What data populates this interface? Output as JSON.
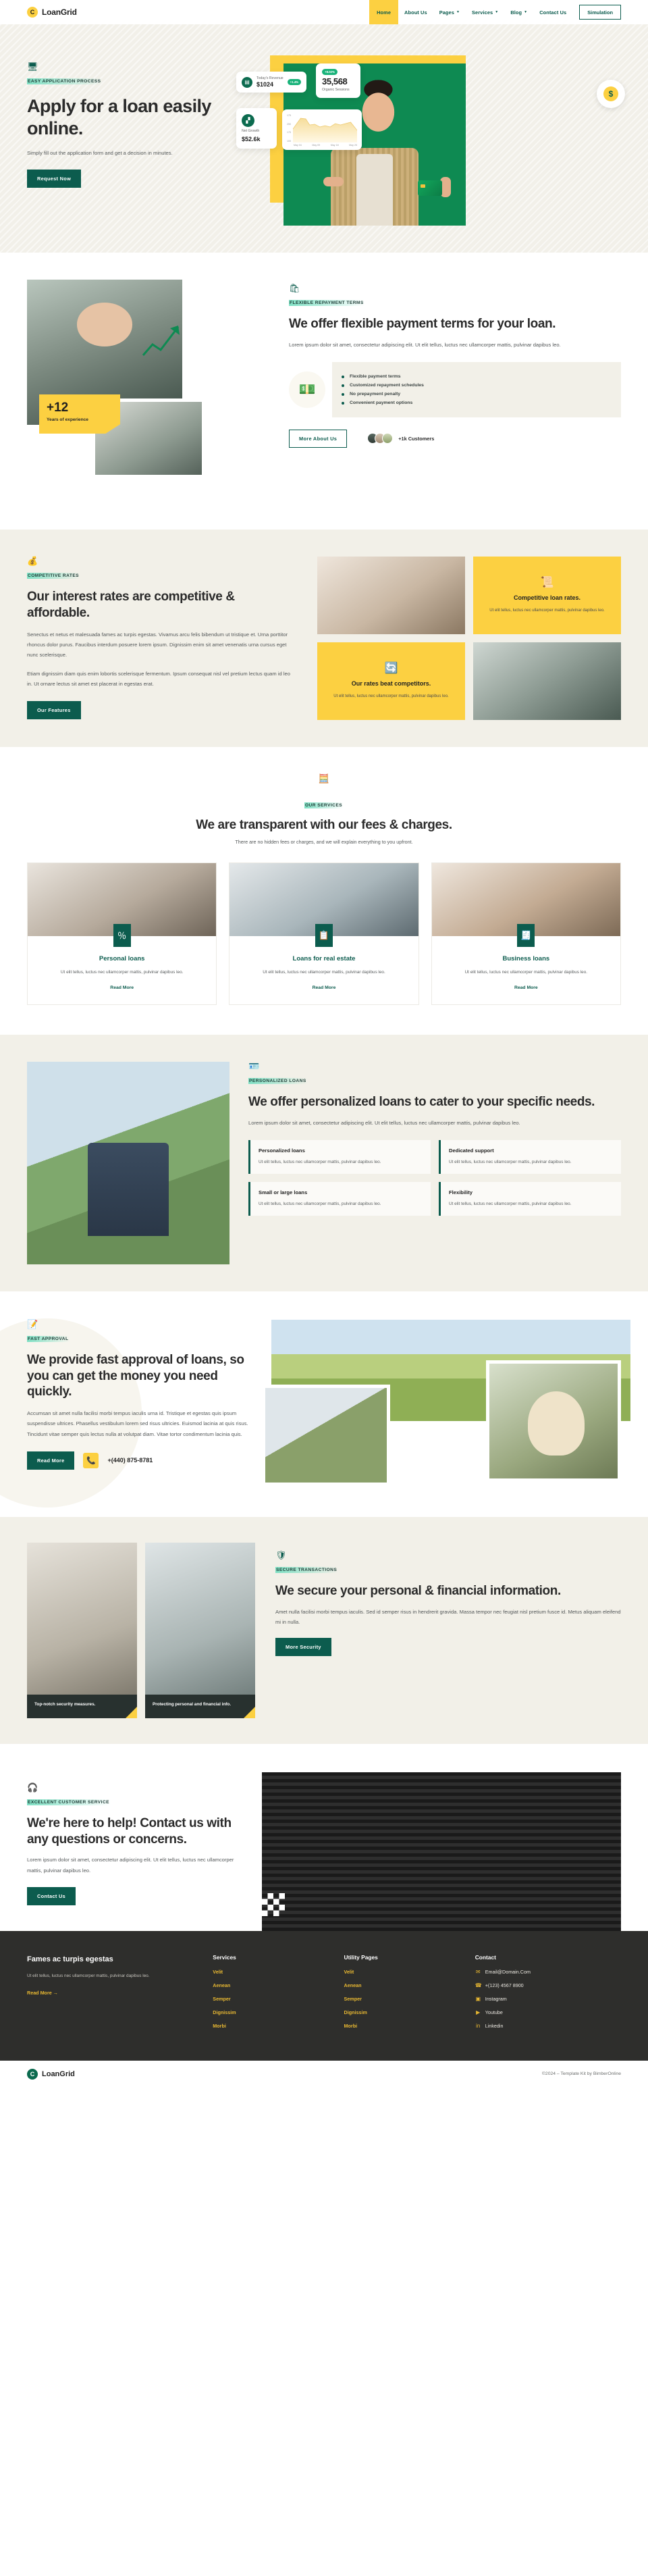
{
  "header": {
    "logo": {
      "mark": "C",
      "name": "LoanGrid"
    },
    "nav": [
      {
        "label": "Home",
        "active": true,
        "caret": false
      },
      {
        "label": "About Us",
        "active": false,
        "caret": false
      },
      {
        "label": "Pages",
        "active": false,
        "caret": true
      },
      {
        "label": "Services",
        "active": false,
        "caret": true
      },
      {
        "label": "Blog",
        "active": false,
        "caret": true
      },
      {
        "label": "Contact Us",
        "active": false,
        "caret": false
      }
    ],
    "cta": "Simulation"
  },
  "hero": {
    "eyebrow": "EASY APPLICATION PROCESS",
    "eyebrow_icon": "monitor-chart-icon",
    "title": "Apply for a loan easily online.",
    "desc": "Simply fill out the application form and get a decision in minutes.",
    "button": "Request Now",
    "cards": {
      "revenue": {
        "label": "Today's Revenue",
        "value": "$1024",
        "badge": "+1.4%",
        "icon": "receipt-icon"
      },
      "growth": {
        "label": "Net Growth",
        "value": "$52.6k",
        "icon": "bar-chart-icon"
      },
      "sessions": {
        "badge": "+8.02%",
        "value": "35,568",
        "label": "Organic Sessions"
      },
      "chart": {
        "y_ticks": [
          "175",
          "250",
          "175",
          "100"
        ],
        "x_ticks": [
          "May 04",
          "May 09",
          "May 18",
          "May 25"
        ]
      },
      "coin_icon": "dollar-refresh-icon"
    }
  },
  "flexible": {
    "eyebrow": "FLEXIBLE REPAYMENT TERMS",
    "eyebrow_icon": "bag-chart-icon",
    "title": "We offer flexible payment terms for your loan.",
    "desc": "Lorem ipsum dolor sit amet, consectetur adipiscing elit. Ut elit tellus, luctus nec ullamcorper mattis, pulvinar dapibus leo.",
    "bullets": [
      "Flexible payment terms",
      "Customized repayment schedules",
      "No prepayment penalty",
      "Convenient payment options"
    ],
    "wallet_icon": "money-wallet-icon",
    "button": "More About Us",
    "customers": "+1k Customers",
    "badge": {
      "number": "+12",
      "label": "Years of experience"
    }
  },
  "rates": {
    "eyebrow": "COMPETITIVE RATES",
    "eyebrow_icon": "money-bag-icon",
    "title": "Our interest rates are competitive & affordable.",
    "para1": "Senectus et netus et malesuada fames ac turpis egestas. Vivamus arcu felis bibendum ut tristique et. Urna porttitor rhoncus dolor purus. Faucibus interdum posuere lorem ipsum. Dignissim enim sit amet venenatis urna cursus eget nunc scelerisque.",
    "para2": "Etiam dignissim diam quis enim lobortis scelerisque fermentum. Ipsum consequat nisl vel pretium lectus quam id leo in. Ut ornare lectus sit amet est placerat in egestas erat.",
    "button": "Our Features",
    "cards": [
      {
        "title": "Competitive loan rates.",
        "desc": "Ut elit tellus, luctus nec ullamcorper mattis, pulvinar dapibus leo.",
        "icon": "certificate-dollar-icon"
      },
      {
        "title": "Our rates beat competitors.",
        "desc": "Ut elit tellus, luctus nec ullamcorper mattis, pulvinar dapibus leo.",
        "icon": "dollar-cycle-icon"
      }
    ]
  },
  "services": {
    "eyebrow": "OUR SERVICES",
    "eyebrow_icon": "calculator-icon",
    "title": "We are transparent with our fees & charges.",
    "subtitle": "There are no hidden fees or charges, and we will explain everything to you upfront.",
    "cards": [
      {
        "title": "Personal loans",
        "desc": "Ut elit tellus, luctus nec ullamcorper mattis, pulvinar dapibus leo.",
        "link": "Read More",
        "icon": "percent-doc-icon"
      },
      {
        "title": "Loans for real estate",
        "desc": "Ut elit tellus, luctus nec ullamcorper mattis, pulvinar dapibus leo.",
        "link": "Read More",
        "icon": "doc-user-icon"
      },
      {
        "title": "Business loans",
        "desc": "Ut elit tellus, luctus nec ullamcorper mattis, pulvinar dapibus leo.",
        "link": "Read More",
        "icon": "doc-calculator-icon"
      }
    ]
  },
  "personalized": {
    "eyebrow": "PERSONALIZED LOANS",
    "eyebrow_icon": "id-card-icon",
    "title": "We offer personalized loans to cater to your specific needs.",
    "desc": "Lorem ipsum dolor sit amet, consectetur adipiscing elit. Ut elit tellus, luctus nec ullamcorper mattis, pulvinar dapibus leo.",
    "features": [
      {
        "title": "Personalized loans",
        "desc": "Ut elit tellus, luctus nec ullamcorper mattis, pulvinar dapibus leo."
      },
      {
        "title": "Dedicated support",
        "desc": "Ut elit tellus, luctus nec ullamcorper mattis, pulvinar dapibus leo."
      },
      {
        "title": "Small or large loans",
        "desc": "Ut elit tellus, luctus nec ullamcorper mattis, pulvinar dapibus leo."
      },
      {
        "title": "Flexibility",
        "desc": "Ut elit tellus, luctus nec ullamcorper mattis, pulvinar dapibus leo."
      }
    ]
  },
  "fast": {
    "eyebrow": "FAST APPROVAL",
    "eyebrow_icon": "checklist-icon",
    "title": "We provide fast approval of loans, so you can get the money you need quickly.",
    "desc": "Accumsan sit amet nulla facilisi morbi tempus iaculis urna id. Tristique et egestas quis ipsum suspendisse ultrices. Phasellus vestibulum lorem sed risus ultricies. Euismod lacinia at quis risus. Tincidunt vitae semper quis lectus nulla at volutpat diam. Vitae tortor condimentum lacinia quis.",
    "button": "Read More",
    "phone": "+(440) 875-8781",
    "phone_icon": "phone-icon"
  },
  "secure": {
    "eyebrow": "SECURE TRANSACTIONS",
    "eyebrow_icon": "shield-lock-icon",
    "title": "We secure your personal & financial information.",
    "desc": "Amet nulla facilisi morbi tempus iaculis. Sed id semper risus in hendrerit gravida. Massa tempor nec feugiat nisl pretium fusce id. Metus aliquam eleifend mi in nulla.",
    "button": "More Security",
    "tiles": [
      {
        "caption": "Top-notch security measures."
      },
      {
        "caption": "Protecting personal and financial info."
      }
    ]
  },
  "contact": {
    "eyebrow": "EXCELLENT CUSTOMER SERVICE",
    "eyebrow_icon": "support-icon",
    "title": "We're here to help! Contact us with any questions or concerns.",
    "desc": "Lorem ipsum dolor sit amet, consectetur adipiscing elit. Ut elit tellus, luctus nec ullamcorper mattis, pulvinar dapibus leo.",
    "button": "Contact Us"
  },
  "footer": {
    "about": {
      "title": "Fames ac turpis egestas",
      "desc": "Ut elit tellus, luctus nec ullamcorper mattis, pulvinar dapibus leo.",
      "more": "Read More  →"
    },
    "columns": [
      {
        "head": "Services",
        "links": [
          "Velit",
          "Aenean",
          "Semper",
          "Dignissim",
          "Morbi"
        ]
      },
      {
        "head": "Utility Pages",
        "links": [
          "Velit",
          "Aenean",
          "Semper",
          "Dignissim",
          "Morbi"
        ]
      }
    ],
    "contact": {
      "head": "Contact",
      "items": [
        {
          "icon": "envelope-icon",
          "glyph": "✉",
          "label": "Email@Domain.Com"
        },
        {
          "icon": "phone-icon",
          "glyph": "☎",
          "label": "+(123) 4567 8900"
        },
        {
          "icon": "instagram-icon",
          "glyph": "▣",
          "label": "Instagram"
        },
        {
          "icon": "youtube-icon",
          "glyph": "▶",
          "label": "Youtube"
        },
        {
          "icon": "linkedin-icon",
          "glyph": "in",
          "label": "Linkedin"
        }
      ]
    },
    "bottom": {
      "logo_mark": "C",
      "logo_name": "LoanGrid",
      "copyright": "©2024 – Template Kit by BimberOnline"
    }
  },
  "colors": {
    "green": "#0c5c4e",
    "yellow": "#fcd041",
    "cream": "#f2f0e8",
    "dark": "#2e2e2c",
    "gold": "#e8b832"
  }
}
